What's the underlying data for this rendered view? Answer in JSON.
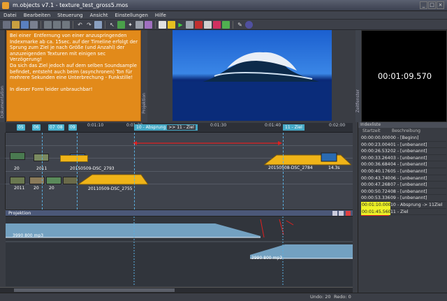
{
  "window": {
    "title": "m.objects v7.1 - texture_test_gross5.mos"
  },
  "menu": [
    "Datei",
    "Bearbeiten",
    "Steuerung",
    "Ansicht",
    "Einstellungen",
    "Hilfe"
  ],
  "note": {
    "text": "Bei einer  Entfernung von einer anzuspringenden Indexmarke ab ca. 15sec. auf der Timeline erfolgt der Sprung zum Ziel je nach Größe (und Anzahl) der anzuzeigenden Texturen mit einigen sec Verzögerung!\nDa sich das Ziel jedoch auf dem selben Soundsample befindet, entsteht auch beim (asynchronen) Ton für mehrere Sekunden eine Unterbrechung - Funkstille!\n\nIn dieser Form leider unbrauchbar!"
  },
  "side_labels": {
    "left": "Dokumentation",
    "projection": "Projektion",
    "right": "Zeitfenster"
  },
  "timecode": "00:01:09.570",
  "ruler": {
    "markers_small": [
      "05",
      "06",
      "07",
      "08",
      "09"
    ],
    "times": [
      "0:01:10",
      "0:01:20",
      "0:01:30",
      "0:01:40",
      "0:02:00"
    ],
    "marker10": "10 - Absprung",
    "marker11_pre": ">> 11 - Ziel",
    "marker11": "11 - Ziel"
  },
  "clips": {
    "a": "20110509-DSC_2755",
    "b": "20150509-DSC_2794",
    "c": "20150509-DSC_2793",
    "d": "20150508-DSC_2784",
    "e": "14.3s"
  },
  "track_labels": [
    "20",
    "2011",
    "2011",
    "20",
    "20"
  ],
  "projection_label": "Projektion",
  "audio": {
    "top_file": "3990 800 mp3",
    "bottom_file": "3990 800 mp3"
  },
  "index_panel": {
    "title": "Indexliste",
    "col_start": "Startzeit",
    "col_desc": "Beschreibung",
    "rows": [
      {
        "time": "00:00:00.000",
        "desc": "00 - [Beginn]",
        "hl": false
      },
      {
        "time": "00:00:23.004",
        "desc": "01 - [unbenannt]",
        "hl": false
      },
      {
        "time": "00:00:26.532",
        "desc": "02 - [unbenannt]",
        "hl": false
      },
      {
        "time": "00:00:33.264",
        "desc": "03 - [unbenannt]",
        "hl": false
      },
      {
        "time": "00:00:36.684",
        "desc": "04 - [unbenannt]",
        "hl": false
      },
      {
        "time": "00:00:40.176",
        "desc": "05 - [unbenannt]",
        "hl": false
      },
      {
        "time": "00:00:43.740",
        "desc": "06 - [unbenannt]",
        "hl": false
      },
      {
        "time": "00:00:47.268",
        "desc": "07 - [unbenannt]",
        "hl": false
      },
      {
        "time": "00:00:50.724",
        "desc": "08 - [unbenannt]",
        "hl": false
      },
      {
        "time": "00:00:53.336",
        "desc": "09 - [unbenannt]",
        "hl": false
      },
      {
        "time": "00:01:10.000",
        "desc": "10 - Absprung -> 11Ziel",
        "hl": true
      },
      {
        "time": "00:01:45.560",
        "desc": "11 - Ziel",
        "hl": true
      }
    ]
  },
  "status": {
    "undo": "Undo: 20",
    "redo": "Redo: 0"
  },
  "colors": {
    "accent_orange": "#e28a1a",
    "marker_blue": "#44a8c5",
    "highlight_yellow": "#eef227",
    "clip_yellow": "#f0b418"
  }
}
